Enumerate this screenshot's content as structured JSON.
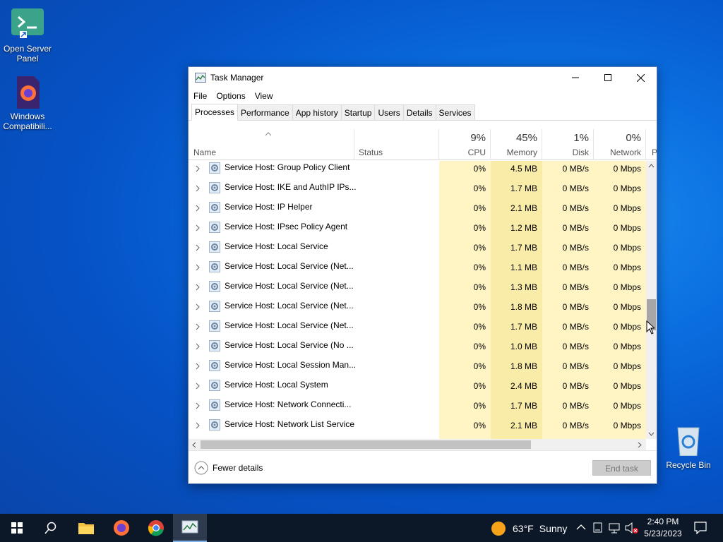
{
  "desktop": {
    "icons": [
      {
        "label": "Open Server Panel"
      },
      {
        "label": "Windows Compatibili..."
      },
      {
        "label": "Recycle Bin"
      }
    ]
  },
  "window": {
    "title": "Task Manager",
    "menu": [
      "File",
      "Options",
      "View"
    ],
    "tabs": [
      "Processes",
      "Performance",
      "App history",
      "Startup",
      "Users",
      "Details",
      "Services"
    ],
    "active_tab": "Processes"
  },
  "table": {
    "columns": {
      "name": "Name",
      "status": "Status",
      "cpu": {
        "pct": "9%",
        "label": "CPU"
      },
      "memory": {
        "pct": "45%",
        "label": "Memory"
      },
      "disk": {
        "pct": "1%",
        "label": "Disk"
      },
      "network": {
        "pct": "0%",
        "label": "Network"
      },
      "power_partial": "P"
    },
    "rows": [
      {
        "name": "Service Host: Group Policy Client",
        "cpu": "0%",
        "memory": "4.5 MB",
        "disk": "0 MB/s",
        "network": "0 Mbps"
      },
      {
        "name": "Service Host: IKE and AuthIP IPs...",
        "cpu": "0%",
        "memory": "1.7 MB",
        "disk": "0 MB/s",
        "network": "0 Mbps"
      },
      {
        "name": "Service Host: IP Helper",
        "cpu": "0%",
        "memory": "2.1 MB",
        "disk": "0 MB/s",
        "network": "0 Mbps"
      },
      {
        "name": "Service Host: IPsec Policy Agent",
        "cpu": "0%",
        "memory": "1.2 MB",
        "disk": "0 MB/s",
        "network": "0 Mbps"
      },
      {
        "name": "Service Host: Local Service",
        "cpu": "0%",
        "memory": "1.7 MB",
        "disk": "0 MB/s",
        "network": "0 Mbps"
      },
      {
        "name": "Service Host: Local Service (Net...",
        "cpu": "0%",
        "memory": "1.1 MB",
        "disk": "0 MB/s",
        "network": "0 Mbps"
      },
      {
        "name": "Service Host: Local Service (Net...",
        "cpu": "0%",
        "memory": "1.3 MB",
        "disk": "0 MB/s",
        "network": "0 Mbps"
      },
      {
        "name": "Service Host: Local Service (Net...",
        "cpu": "0%",
        "memory": "1.8 MB",
        "disk": "0 MB/s",
        "network": "0 Mbps"
      },
      {
        "name": "Service Host: Local Service (Net...",
        "cpu": "0%",
        "memory": "1.7 MB",
        "disk": "0 MB/s",
        "network": "0 Mbps"
      },
      {
        "name": "Service Host: Local Service (No ...",
        "cpu": "0%",
        "memory": "1.0 MB",
        "disk": "0 MB/s",
        "network": "0 Mbps"
      },
      {
        "name": "Service Host: Local Session Man...",
        "cpu": "0%",
        "memory": "1.8 MB",
        "disk": "0 MB/s",
        "network": "0 Mbps"
      },
      {
        "name": "Service Host: Local System",
        "cpu": "0%",
        "memory": "2.4 MB",
        "disk": "0 MB/s",
        "network": "0 Mbps"
      },
      {
        "name": "Service Host: Network Connecti...",
        "cpu": "0%",
        "memory": "1.7 MB",
        "disk": "0 MB/s",
        "network": "0 Mbps"
      },
      {
        "name": "Service Host: Network List Service",
        "cpu": "0%",
        "memory": "2.1 MB",
        "disk": "0 MB/s",
        "network": "0 Mbps"
      }
    ]
  },
  "footer": {
    "fewer_details": "Fewer details",
    "end_task": "End task"
  },
  "taskbar": {
    "weather": {
      "temp": "63°F",
      "condition": "Sunny"
    },
    "time": "2:40 PM",
    "date": "5/23/2023"
  },
  "colors": {
    "heat_light": "#fff4c4",
    "heat_medium": "#f9eca8",
    "taskbar": "#0c1727",
    "desktop": "#0a6ee0"
  }
}
